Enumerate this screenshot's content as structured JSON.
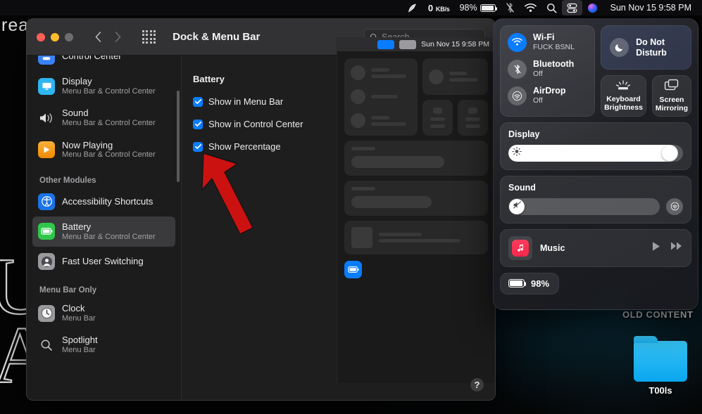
{
  "menubar": {
    "network_speed": "0",
    "network_unit": "KB/s",
    "battery_percent": "98%",
    "clock": "Sun Nov 15  9:58 PM",
    "icons": [
      "feather-icon",
      "bluetooth-off-icon",
      "wifi-icon",
      "search-icon",
      "control-center-icon",
      "siri-icon"
    ]
  },
  "window": {
    "title": "Dock & Menu Bar",
    "search_placeholder": "Search",
    "help_label": "?",
    "sidebar": {
      "items_top": [
        {
          "label": "Control Center",
          "sub": "",
          "icon": "control-center-icon",
          "color": "#3b82f6",
          "selected": false
        },
        {
          "label": "Display",
          "sub": "Menu Bar & Control Center",
          "icon": "display-icon",
          "color": "#2fb6f2",
          "selected": false
        },
        {
          "label": "Sound",
          "sub": "Menu Bar & Control Center",
          "icon": "sound-icon",
          "color": "#d6d6d6",
          "selected": false
        },
        {
          "label": "Now Playing",
          "sub": "Menu Bar & Control Center",
          "icon": "now-playing-icon",
          "color": "#f5a623",
          "selected": false
        }
      ],
      "section_other": "Other Modules",
      "items_other": [
        {
          "label": "Accessibility Shortcuts",
          "sub": "",
          "icon": "accessibility-icon",
          "color": "#1a73e8",
          "selected": false
        },
        {
          "label": "Battery",
          "sub": "Menu Bar & Control Center",
          "icon": "battery-icon",
          "color": "#2fc84a",
          "selected": true
        },
        {
          "label": "Fast User Switching",
          "sub": "",
          "icon": "user-icon",
          "color": "#9a9a9e",
          "selected": false
        }
      ],
      "section_menubar": "Menu Bar Only",
      "items_menubar": [
        {
          "label": "Clock",
          "sub": "Menu Bar",
          "icon": "clock-icon",
          "color": "#9a9a9e",
          "selected": false
        },
        {
          "label": "Spotlight",
          "sub": "Menu Bar",
          "icon": "spotlight-icon",
          "color": "#8a8a8e",
          "selected": false
        }
      ]
    },
    "pane": {
      "title": "Battery",
      "checkboxes": [
        {
          "label": "Show in Menu Bar",
          "checked": true
        },
        {
          "label": "Show in Control Center",
          "checked": true
        },
        {
          "label": "Show Percentage",
          "checked": true
        }
      ]
    },
    "preview": {
      "clock": "Sun Nov 15  9:58 PM"
    }
  },
  "control_center": {
    "wifi": {
      "title": "Wi-Fi",
      "sub": "FUCK BSNL",
      "state": "on"
    },
    "bluetooth": {
      "title": "Bluetooth",
      "sub": "Off",
      "state": "off"
    },
    "airdrop": {
      "title": "AirDrop",
      "sub": "Off",
      "state": "off"
    },
    "do_not_disturb": {
      "title": "Do Not\nDisturb",
      "line1": "Do Not",
      "line2": "Disturb"
    },
    "keyboard_brightness": {
      "line1": "Keyboard",
      "line2": "Brightness"
    },
    "screen_mirroring": {
      "line1": "Screen",
      "line2": "Mirroring"
    },
    "display": {
      "title": "Display",
      "value": 97
    },
    "sound": {
      "title": "Sound",
      "value": 0
    },
    "music": {
      "title": "Music",
      "play": "play-icon",
      "next": "next-icon"
    },
    "battery": {
      "percent": "98%"
    }
  },
  "desktop": {
    "wallpaper_word": "rea",
    "wallpaper_letters": [
      "U",
      "A",
      "."
    ],
    "hidden_text": "OLD CONTENT",
    "folder_label": "T00ls"
  },
  "colors": {
    "accent_blue": "#0a7cff",
    "battery_green": "#2fc84a",
    "arrow_red": "#cc1111"
  }
}
